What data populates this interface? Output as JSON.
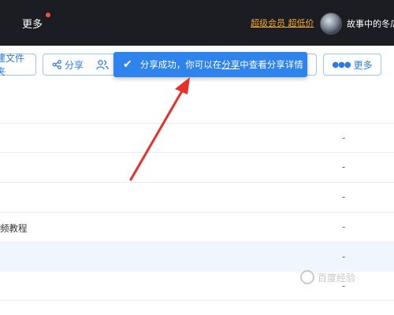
{
  "topbar": {
    "more_label": "更多",
    "vip_link": "超级会员 超低价",
    "username": "故事中的冬瓜"
  },
  "toolbar": {
    "new_folder_label": "建文件夹",
    "share_label": "分享",
    "more_label": "更多"
  },
  "toast": {
    "text_before": "分享成功，你可以在",
    "link_text": "分享",
    "text_after": "中查看分享详情"
  },
  "rows": [
    {
      "name": "",
      "size": "-"
    },
    {
      "name": "",
      "size": "-"
    },
    {
      "name": "",
      "size": "-"
    },
    {
      "name": "频教程",
      "size": "-"
    },
    {
      "name": "",
      "size": "-"
    },
    {
      "name": "",
      "size": "-"
    }
  ],
  "watermark": "百度经验",
  "colors": {
    "topbar_bg": "#1c1d22",
    "accent_blue": "#2e83ec",
    "vip_orange": "#f5a623",
    "arrow_red": "#e8302a",
    "row_highlight": "#f0f6fe"
  }
}
